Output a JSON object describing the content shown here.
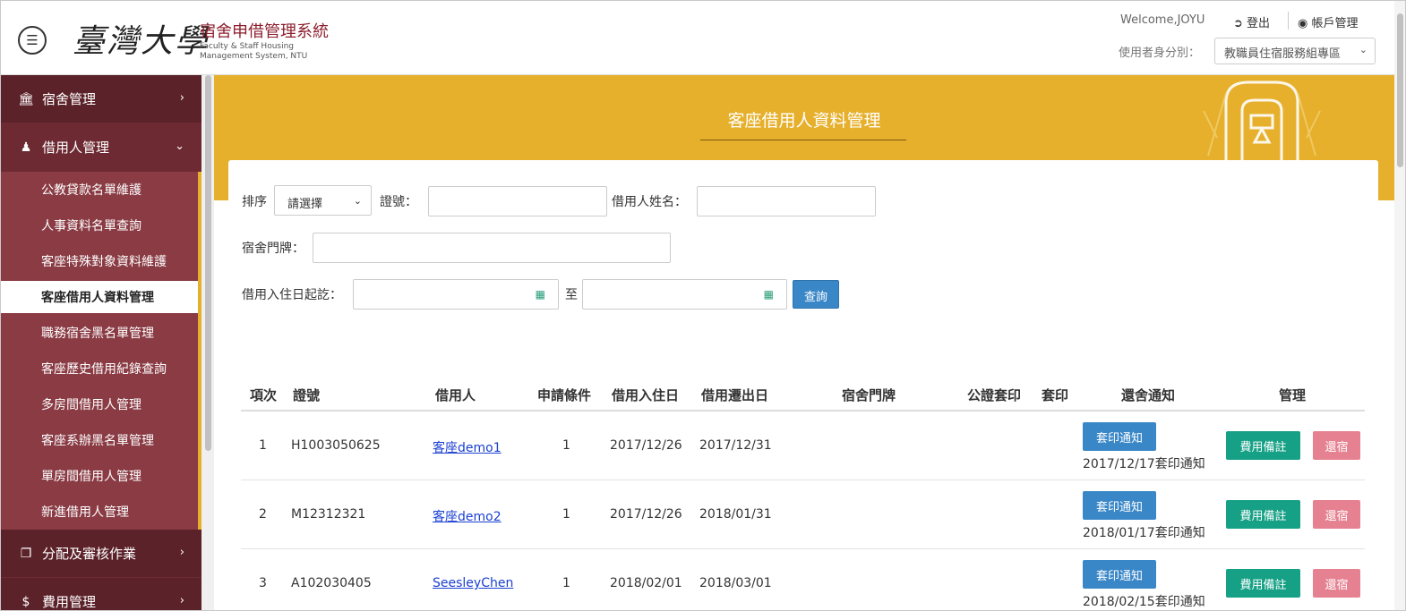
{
  "header": {
    "logo_cn": "臺灣大學",
    "system_name": "宿舍申借管理系統",
    "system_en_1": "Faculty & Staff Housing",
    "system_en_2": "Management System, NTU",
    "welcome": "Welcome,JOYU",
    "logout": "登出",
    "account": "帳戶管理",
    "role_label": "使用者身分別：",
    "role_value": "教職員住宿服務組專區"
  },
  "sidebar": {
    "sections": [
      {
        "label": "宿舍管理"
      },
      {
        "label": "借用人管理"
      },
      {
        "label": "分配及審核作業"
      },
      {
        "label": "費用管理"
      }
    ],
    "items": [
      {
        "label": "公教貸款名單維護"
      },
      {
        "label": "人事資料名單查詢"
      },
      {
        "label": "客座特殊對象資料維護"
      },
      {
        "label": "客座借用人資料管理"
      },
      {
        "label": "職務宿舍黑名單管理"
      },
      {
        "label": "客座歷史借用紀錄查詢"
      },
      {
        "label": "多房間借用人管理"
      },
      {
        "label": "客座系辦黑名單管理"
      },
      {
        "label": "單房間借用人管理"
      },
      {
        "label": "新進借用人管理"
      }
    ]
  },
  "page": {
    "title": "客座借用人資料管理"
  },
  "search": {
    "sort_label": "排序",
    "sort_value": "請選擇",
    "id_label": "證號：",
    "name_label": "借用人姓名：",
    "door_label": "宿舍門牌：",
    "date_label": "借用入住日起訖：",
    "date_to": "至",
    "query_button": "查詢"
  },
  "table": {
    "headers": [
      "項次",
      "證號",
      "借用人",
      "申請條件",
      "借用入住日",
      "借用遷出日",
      "宿舍門牌",
      "公證套印",
      "套印",
      "還舍通知",
      "管理"
    ],
    "print_button": "套印通知",
    "fee_button": "費用備註",
    "return_button": "還宿",
    "rows": [
      {
        "no": "1",
        "id": "H1003050625",
        "borrower": "客座demo1",
        "condition": "1",
        "checkin": "2017/12/26",
        "checkout": "2017/12/31",
        "notice_date": "2017/12/17套印通知"
      },
      {
        "no": "2",
        "id": "M12312321",
        "borrower": "客座demo2",
        "condition": "1",
        "checkin": "2017/12/26",
        "checkout": "2018/01/31",
        "notice_date": "2018/01/17套印通知"
      },
      {
        "no": "3",
        "id": "A102030405",
        "borrower": "SeesleyChen",
        "condition": "1",
        "checkin": "2018/02/01",
        "checkout": "2018/03/01",
        "notice_date": "2018/02/15套印通知"
      }
    ]
  }
}
